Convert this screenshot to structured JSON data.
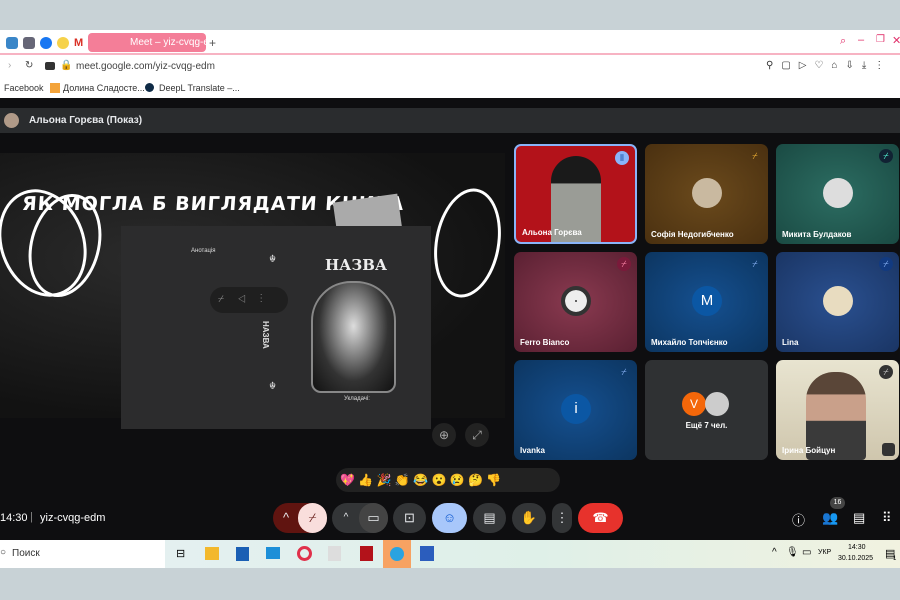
{
  "browser": {
    "tab_title": "Meet – yiz-cvqg-edm",
    "url": "meet.google.com/yiz-cvqg-edm",
    "bookmarks": [
      "Facebook",
      "Долина Сладосте...",
      "DeepL Translate –..."
    ]
  },
  "presenter": {
    "label": "Альона Горєва (Показ)"
  },
  "slide": {
    "title": "ЯК МОГЛА Б ВИГЛЯДАТИ КНИГА",
    "annotation": "Анотація",
    "book_title": "НАЗВА",
    "spine_title": "НАЗВА",
    "compiler": "Укладачі:"
  },
  "participants": [
    {
      "name": "Альона Горєва",
      "bg": "#b3121a",
      "speaking": true
    },
    {
      "name": "Софія Недогибченко",
      "bg": "#5a3d14",
      "muted": true
    },
    {
      "name": "Микита Булдаков",
      "bg": "#1f5a52",
      "muted": true
    },
    {
      "name": "Ferro Bianco",
      "bg": "#6a2a3c",
      "muted": true
    },
    {
      "name": "Михайло Топчієнко",
      "bg": "#0f3f6e",
      "muted": true,
      "initial": "M"
    },
    {
      "name": "Lina",
      "bg": "#1f3f72",
      "muted": true
    },
    {
      "name": "Ivanka",
      "bg": "#0f3f6e",
      "muted": true,
      "initial": "i"
    },
    {
      "more_label": "Ещё 7 чел.",
      "initial": "V"
    },
    {
      "name": "Ірина Бойцун",
      "bg": "#d9d2bc",
      "muted": true
    }
  ],
  "reactions": [
    "💖",
    "👍",
    "🎉",
    "👏",
    "😂",
    "😮",
    "😢",
    "🤔",
    "👎"
  ],
  "footer": {
    "time": "14:30",
    "meeting_code": "yiz-cvqg-edm",
    "people_count": "16"
  },
  "taskbar": {
    "search": "Поиск",
    "lang": "УКР",
    "time": "14:30",
    "date": "30.10.2025",
    "notifications": "1"
  }
}
